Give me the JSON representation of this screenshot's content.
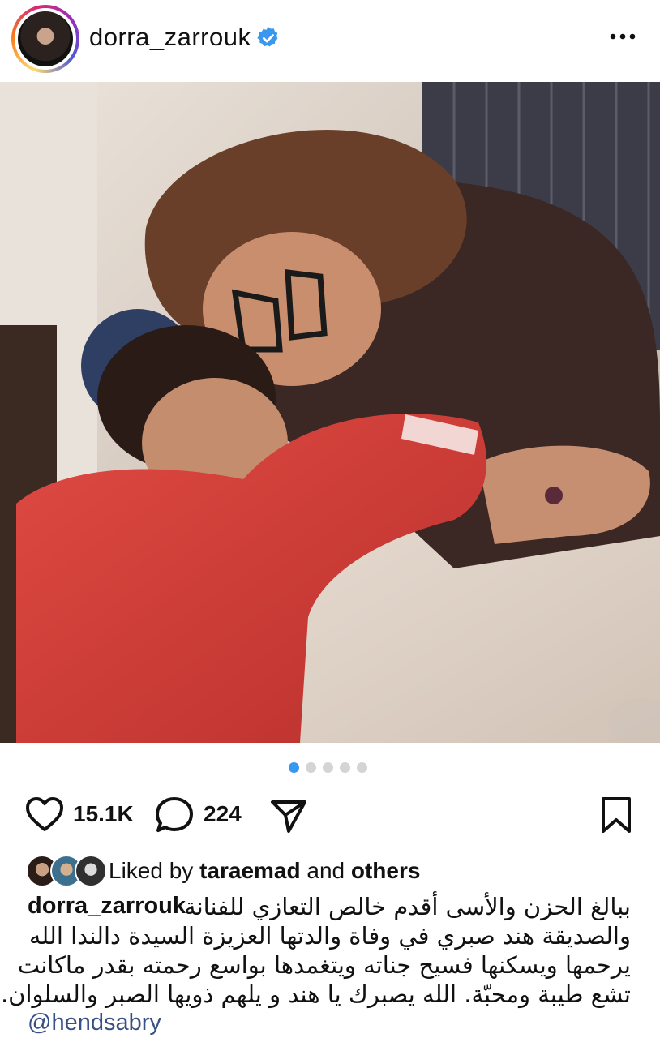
{
  "header": {
    "username": "dorra_zarrouk",
    "verified": true,
    "verified_icon": "verified-badge-icon",
    "more_icon": "more-horizontal-icon"
  },
  "photo": {
    "carousel_total": 5,
    "carousel_active": 1
  },
  "actions": {
    "likes_count": "15.1K",
    "comments_count": "224",
    "like_icon": "heart-icon",
    "comment_icon": "comment-icon",
    "share_icon": "send-icon",
    "save_icon": "bookmark-icon"
  },
  "likes": {
    "prefix": "Liked by ",
    "user": "taraemad",
    "middle": " and ",
    "others": "others"
  },
  "caption": {
    "username": "dorra_zarrouk",
    "lines": [
      "ببالغ الحزن والأسى أقدم خالص التعازي للفنانة",
      "والصديقة هند صبري في وفاة والدتها العزيزة السيدة دالندا الله",
      "يرحمها ويسكنها فسيح جناته ويتغمدها بواسع رحمته بقدر ماكانت",
      "تشع طيبة ومحبّة. الله يصبرك يا هند و يلهم ذويها الصبر والسلوان."
    ],
    "mention": "@hendsabry"
  },
  "colors": {
    "link": "#385185",
    "active_dot": "#3897f0",
    "verified": "#3897f0"
  }
}
